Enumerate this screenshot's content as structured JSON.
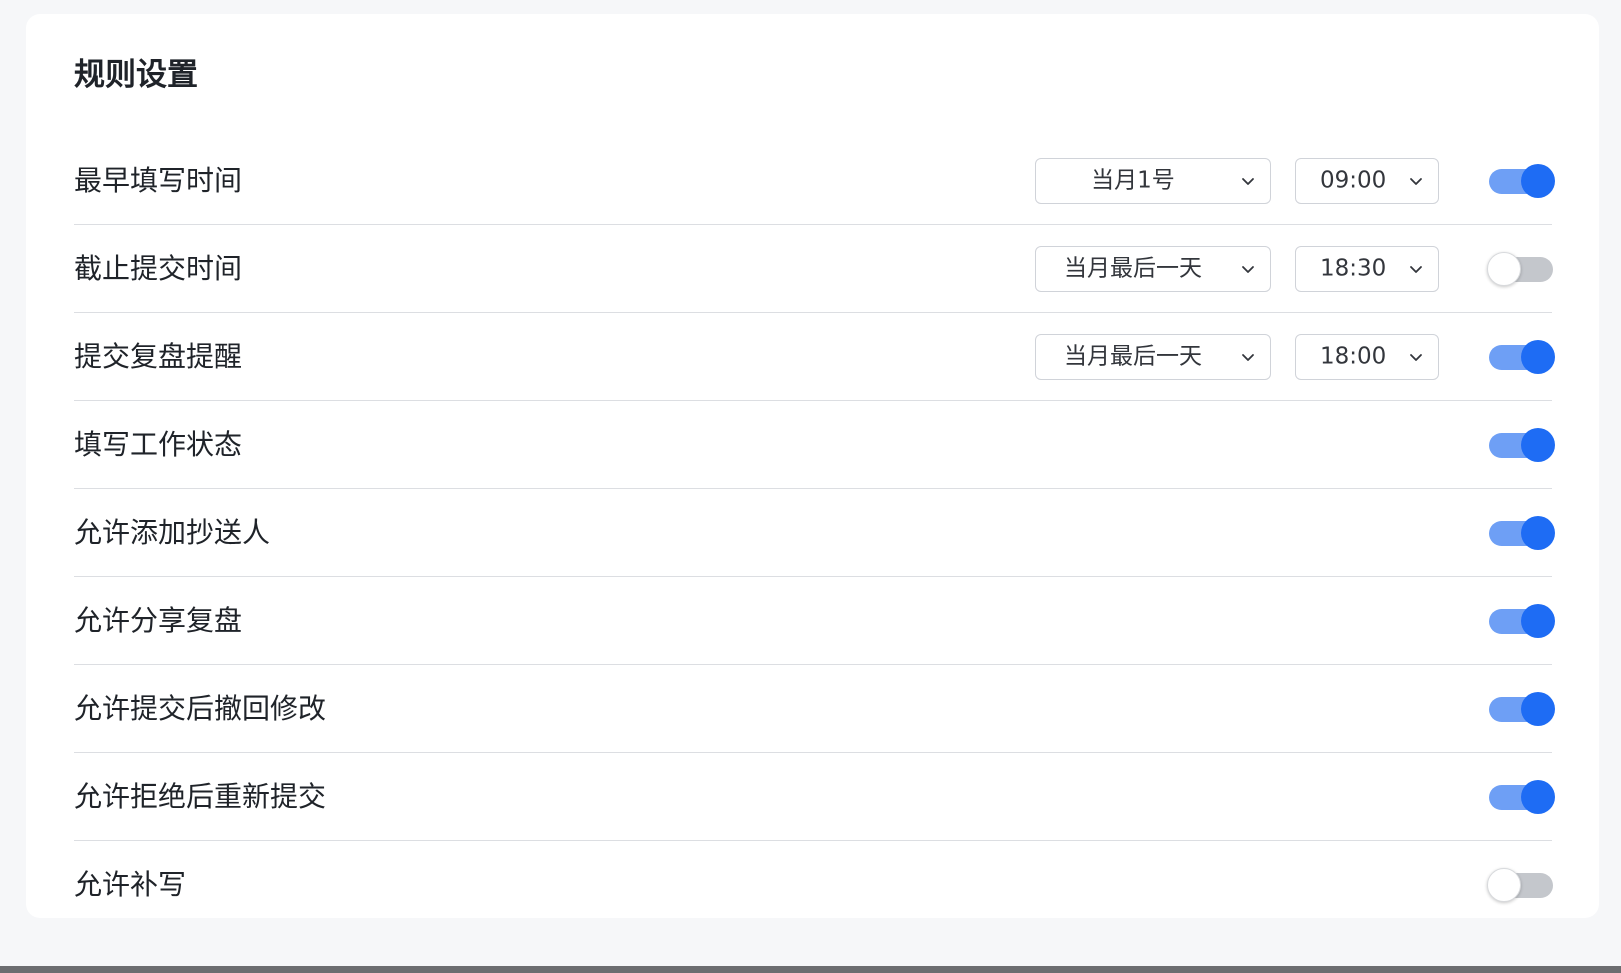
{
  "page": {
    "title": "规则设置"
  },
  "rows": [
    {
      "label": "最早填写时间",
      "day": "当月1号",
      "time": "09:00",
      "enabled": true
    },
    {
      "label": "截止提交时间",
      "day": "当月最后一天",
      "time": "18:30",
      "enabled": false
    },
    {
      "label": "提交复盘提醒",
      "day": "当月最后一天",
      "time": "18:00",
      "enabled": true
    },
    {
      "label": "填写工作状态",
      "enabled": true
    },
    {
      "label": "允许添加抄送人",
      "enabled": true
    },
    {
      "label": "允许分享复盘",
      "enabled": true
    },
    {
      "label": "允许提交后撤回修改",
      "enabled": true
    },
    {
      "label": "允许拒绝后重新提交",
      "enabled": true
    },
    {
      "label": "允许补写",
      "enabled": false
    }
  ],
  "icons": {
    "dropdown": "chevron-down-icon"
  },
  "colors": {
    "toggle_on_knob": "#1e6cf4",
    "toggle_on_track": "#6e9ff5",
    "toggle_off_track": "#c4c7cc",
    "background": "#f6f7f9"
  }
}
